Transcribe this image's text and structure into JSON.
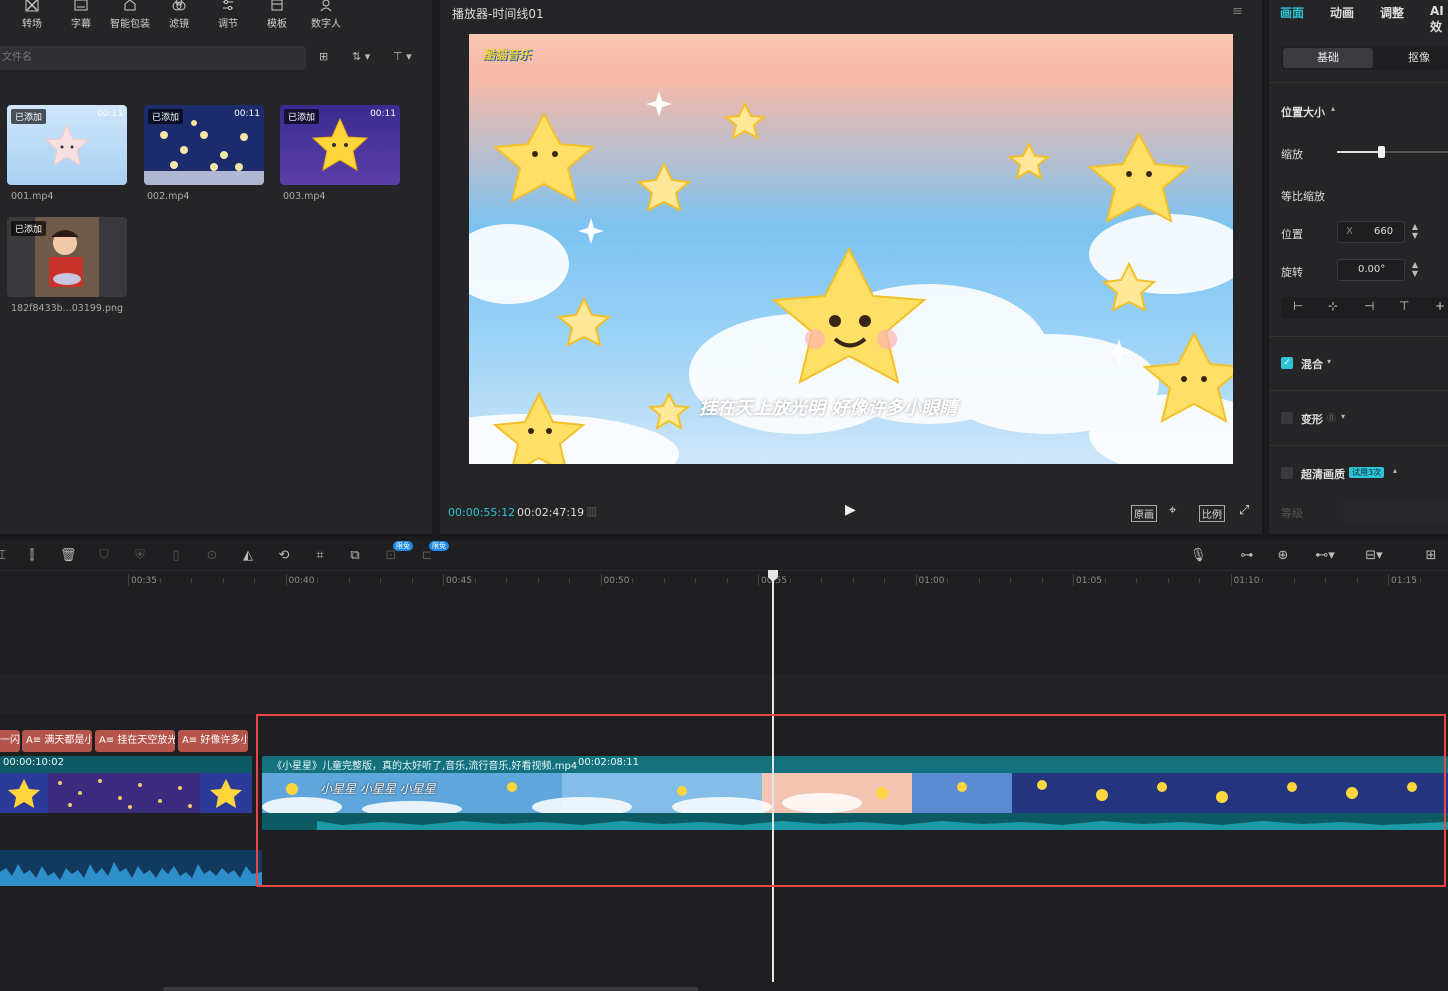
{
  "toolbar": {
    "items": [
      {
        "label": "转场",
        "icon": "transition-icon"
      },
      {
        "label": "字幕",
        "icon": "subtitle-icon"
      },
      {
        "label": "智能包装",
        "icon": "smart-package-icon"
      },
      {
        "label": "滤镜",
        "icon": "filter-icon"
      },
      {
        "label": "调节",
        "icon": "adjust-icon"
      },
      {
        "label": "模板",
        "icon": "template-icon"
      },
      {
        "label": "数字人",
        "icon": "digital-human-icon"
      }
    ]
  },
  "media": {
    "search_placeholder": "文件名",
    "items": [
      {
        "badge": "已添加",
        "duration": "00:11",
        "name": "001.mp4"
      },
      {
        "badge": "已添加",
        "duration": "00:11",
        "name": "002.mp4"
      },
      {
        "badge": "已添加",
        "duration": "00:11",
        "name": "003.mp4"
      },
      {
        "badge": "已添加",
        "duration": "",
        "name": "182f8433b...03199.png"
      }
    ]
  },
  "player": {
    "title": "播放器-时间线01",
    "logo_text": "酷猫音乐",
    "subtitle": "挂在天上放光明 好像许多小眼睛",
    "current_time": "00:00:55:12",
    "total_time": "00:02:47:19",
    "btn_original": "原画",
    "btn_ratio": "比例"
  },
  "inspector": {
    "tabs": [
      "画面",
      "动画",
      "调整",
      "AI效"
    ],
    "subtabs": [
      "基础",
      "抠像"
    ],
    "section_position_size": "位置大小",
    "scale_label": "缩放",
    "scale_value": 0.4,
    "uniform_scale_label": "等比缩放",
    "position_label": "位置",
    "position_x_prefix": "X",
    "position_x": "660",
    "rotation_label": "旋转",
    "rotation_value": "0.00°",
    "blend_label": "混合",
    "deform_label": "变形",
    "hd_label": "超清画质",
    "hd_badge": "试用3次",
    "level_label": "等级"
  },
  "timeline": {
    "free_badge": "限免",
    "ruler": [
      "00:35",
      "00:40",
      "00:45",
      "00:50",
      "00:55",
      "01:00",
      "01:05",
      "01:10",
      "01:15"
    ],
    "text_clips": [
      "一闪",
      "满天都是小",
      "挂在天空放光",
      "好像许多小"
    ],
    "clip1_time": "00:00:10:02",
    "clip2_title": "《小星星》儿童完整版，真的太好听了,音乐,流行音乐,好看视频.mp4",
    "clip2_duration": "00:02:08:11",
    "clip2_caption": "小星星 小星星 小星星"
  },
  "colors": {
    "accent": "#2ec4d8",
    "highlight": "#e8474a",
    "text_clip": "#b5544a",
    "video_track": "#1a6e7a"
  }
}
